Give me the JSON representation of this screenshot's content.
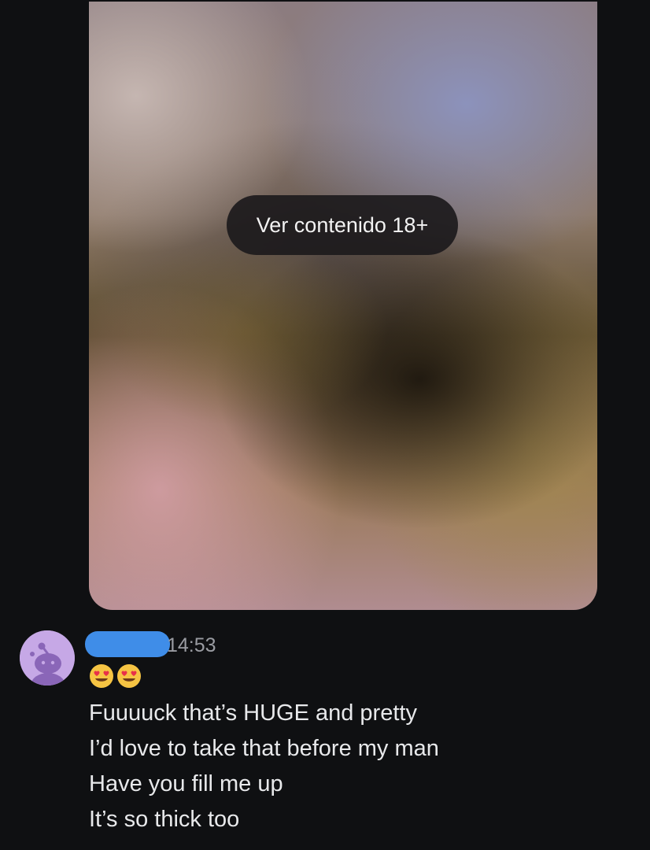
{
  "media": {
    "nsfw_button_label": "Ver contenido 18+"
  },
  "message": {
    "timestamp": "14:53",
    "emoji": [
      "smiling-face-with-heart-eyes",
      "smiling-face-with-heart-eyes"
    ],
    "lines": [
      "Fuuuuck that’s HUGE and pretty",
      "I’d love to take that before my man",
      "Have you fill me up",
      "It’s so thick too"
    ]
  },
  "colors": {
    "background": "#0f1012",
    "avatar_bg": "#c6a8e6",
    "redaction": "#3f8de8",
    "timestamp": "#9a9ca2",
    "message_text": "#e8e9eb"
  }
}
